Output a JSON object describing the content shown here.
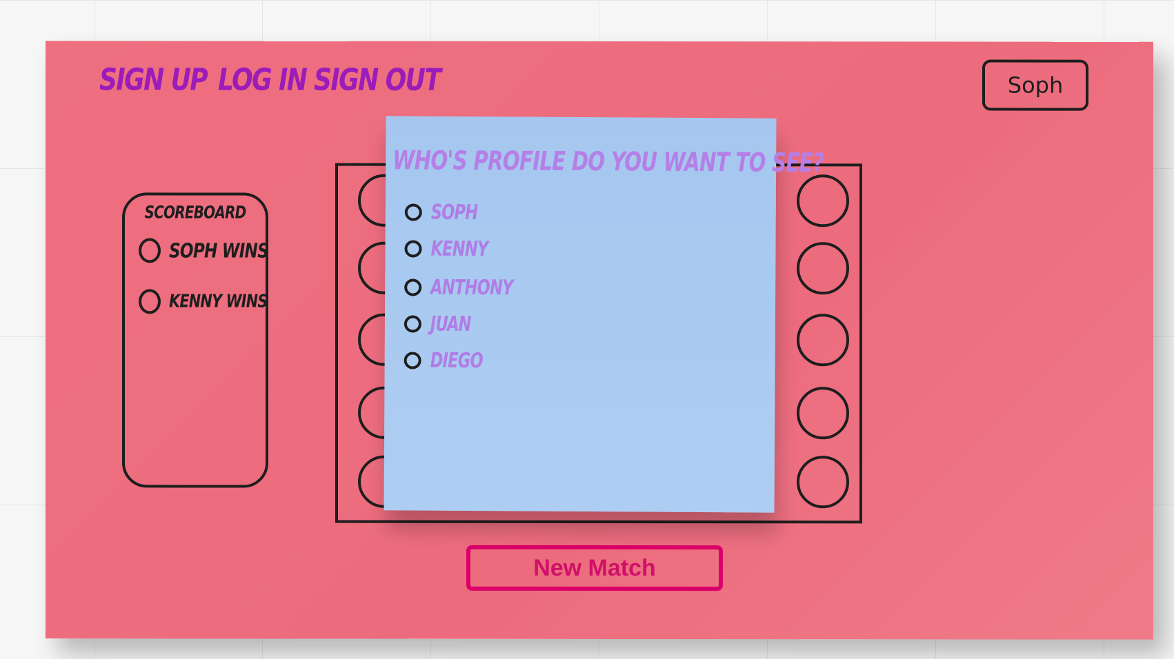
{
  "nav": {
    "links": [
      "Sign up",
      "Log in",
      "Sign out"
    ]
  },
  "user": {
    "name": "Soph"
  },
  "scoreboard": {
    "title": "Scoreboard",
    "entries": [
      "Soph Wins",
      "Kenny Wins"
    ]
  },
  "popup": {
    "title": "Who's profile do you want to see?",
    "options": [
      "Soph",
      "Kenny",
      "Anthony",
      "Juan",
      "Diego"
    ]
  },
  "actions": {
    "new_match": "New Match"
  },
  "colors": {
    "board": "#ee6f80",
    "nav_text": "#9b1cb8",
    "popup_bg": "#a5c7ef",
    "popup_text": "#b57fe7",
    "new_match": "#d9006a"
  }
}
